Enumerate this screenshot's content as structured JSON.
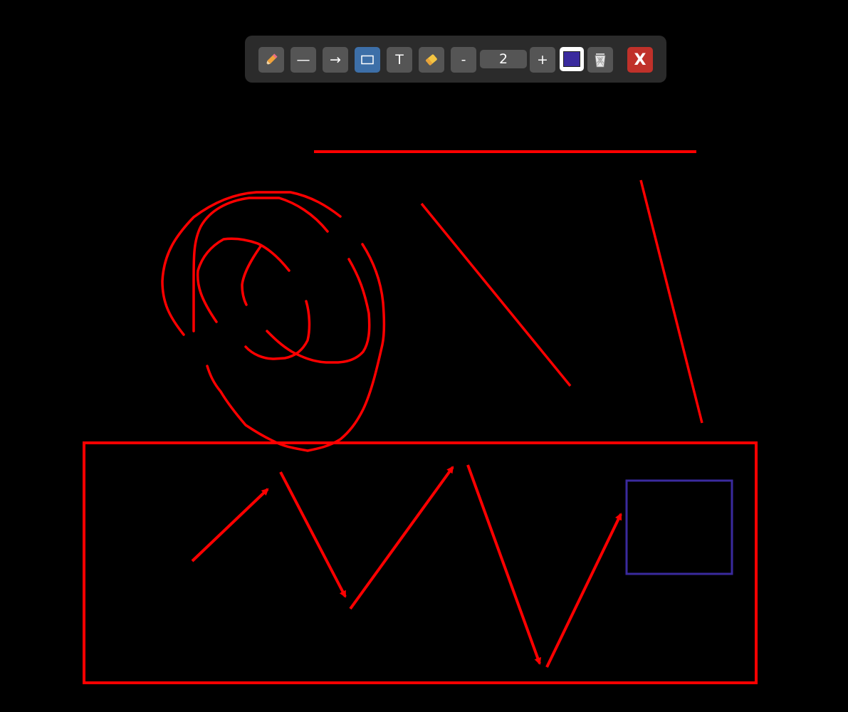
{
  "toolbar": {
    "pen_icon": "pencil-icon",
    "line_label": "—",
    "arrow_label": "→",
    "rect_icon": "rectangle-icon",
    "text_label": "T",
    "eraser_icon": "eraser-icon",
    "decrease_label": "-",
    "brush_size": "2",
    "increase_label": "+",
    "selected_color": "#3a2a9e",
    "clear_icon": "trash-icon",
    "close_label": "X",
    "active_tool": "rectangle"
  },
  "drawing": {
    "primary_stroke": "#ff0000",
    "rect_stroke": "#3a2a9e"
  }
}
